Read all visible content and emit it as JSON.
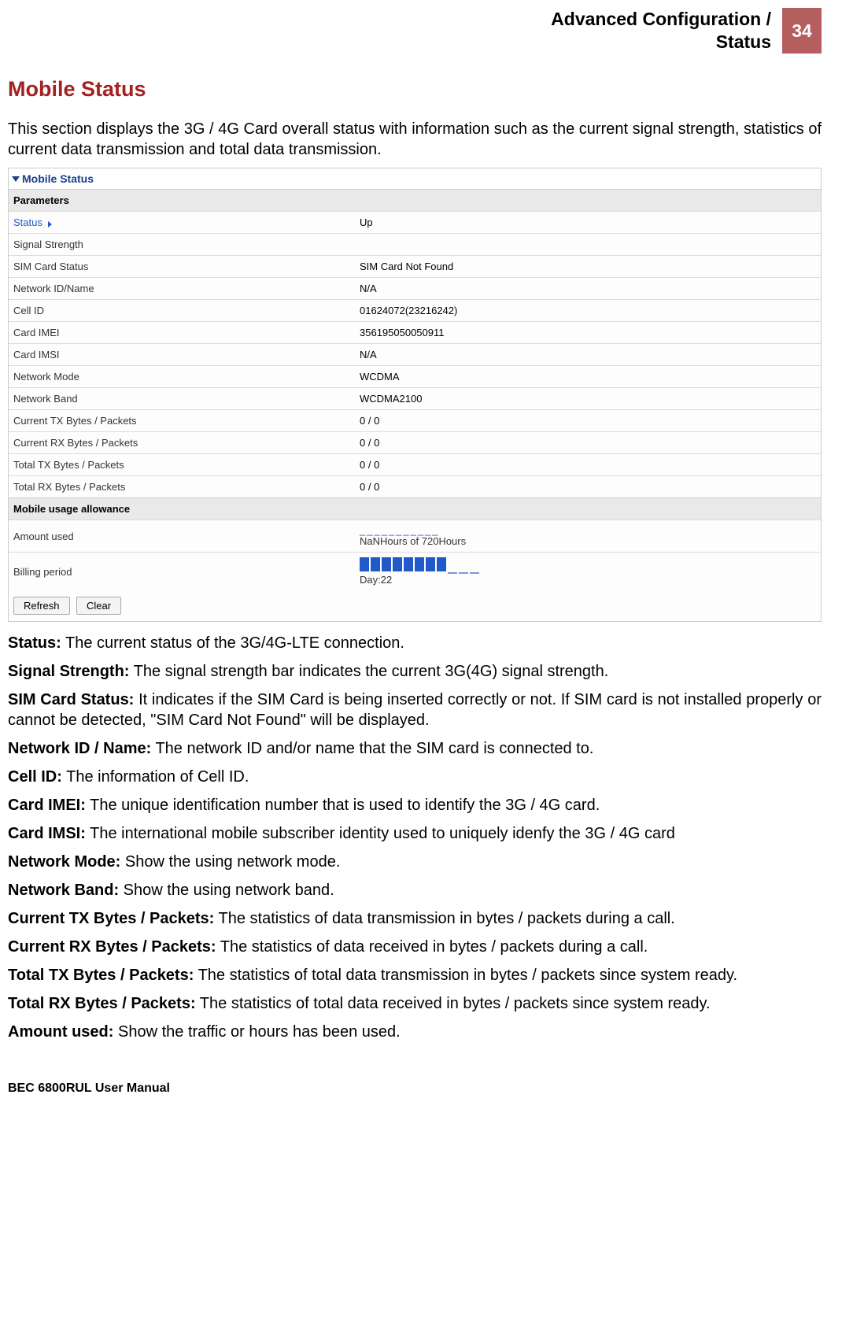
{
  "header": {
    "title_line1": "Advanced Configuration /",
    "title_line2": "Status",
    "page_number": "34"
  },
  "section_title": "Mobile Status",
  "intro": "This section displays the 3G / 4G Card overall status with information such as the current signal strength, statistics of current data transmission and total data transmission.",
  "panel": {
    "head": "Mobile Status",
    "parameters_label": "Parameters",
    "rows": {
      "status_lbl": "Status",
      "status_val": "Up",
      "signal_lbl": "Signal Strength",
      "signal_val": "",
      "sim_lbl": "SIM Card Status",
      "sim_val": "SIM Card Not Found",
      "netid_lbl": "Network ID/Name",
      "netid_val": "N/A",
      "cell_lbl": "Cell ID",
      "cell_val": "01624072(23216242)",
      "imei_lbl": "Card IMEI",
      "imei_val": "356195050050911",
      "imsi_lbl": "Card IMSI",
      "imsi_val": "N/A",
      "mode_lbl": "Network Mode",
      "mode_val": "WCDMA",
      "band_lbl": "Network Band",
      "band_val": "WCDMA2100",
      "ctx_lbl": "Current TX Bytes / Packets",
      "ctx_val": "0 / 0",
      "crx_lbl": "Current RX Bytes / Packets",
      "crx_val": "0 / 0",
      "ttx_lbl": "Total TX Bytes / Packets",
      "ttx_val": "0 / 0",
      "trx_lbl": "Total RX Bytes / Packets",
      "trx_val": "0 / 0"
    },
    "usage_label": "Mobile usage allowance",
    "amount_lbl": "Amount used",
    "amount_text": "NaNHours of 720Hours",
    "billing_lbl": "Billing period",
    "billing_text": "Day:22",
    "buttons": {
      "refresh": "Refresh",
      "clear": "Clear"
    }
  },
  "defs": [
    {
      "t": "Status:",
      "d": " The current status of the 3G/4G-LTE connection."
    },
    {
      "t": "Signal Strength:",
      "d": " The signal strength bar indicates the current 3G(4G) signal strength."
    },
    {
      "t": "SIM Card Status:",
      "d": " It indicates if the SIM Card is being inserted correctly or not. If SIM card is not installed properly or cannot be detected, \"SIM Card Not Found\" will be displayed."
    },
    {
      "t": "Network ID / Name:",
      "d": " The network ID and/or name that the SIM card is connected to."
    },
    {
      "t": "Cell ID:",
      "d": " The information of Cell ID."
    },
    {
      "t": "Card IMEI:",
      "d": " The unique identification number that is used to identify the 3G / 4G card."
    },
    {
      "t": "Card IMSI:",
      "d": " The international mobile subscriber identity used to uniquely idenfy the 3G / 4G card"
    },
    {
      "t": "Network Mode:",
      "d": " Show the using network mode."
    },
    {
      "t": "Network Band:",
      "d": " Show the using network band."
    },
    {
      "t": "Current TX Bytes / Packets:",
      "d": " The statistics of data transmission in bytes / packets during a call."
    },
    {
      "t": "Current RX Bytes / Packets:",
      "d": " The statistics of data received in bytes / packets during a call."
    },
    {
      "t": "Total TX Bytes / Packets:",
      "d": " The statistics of total data transmission in bytes / packets since system ready."
    },
    {
      "t": "Total RX Bytes / Packets:",
      "d": " The statistics of total data received in bytes / packets since system ready."
    },
    {
      "t": "Amount used:",
      "d": " Show the traffic or hours has been used."
    }
  ],
  "footer": "BEC 6800RUL User Manual"
}
